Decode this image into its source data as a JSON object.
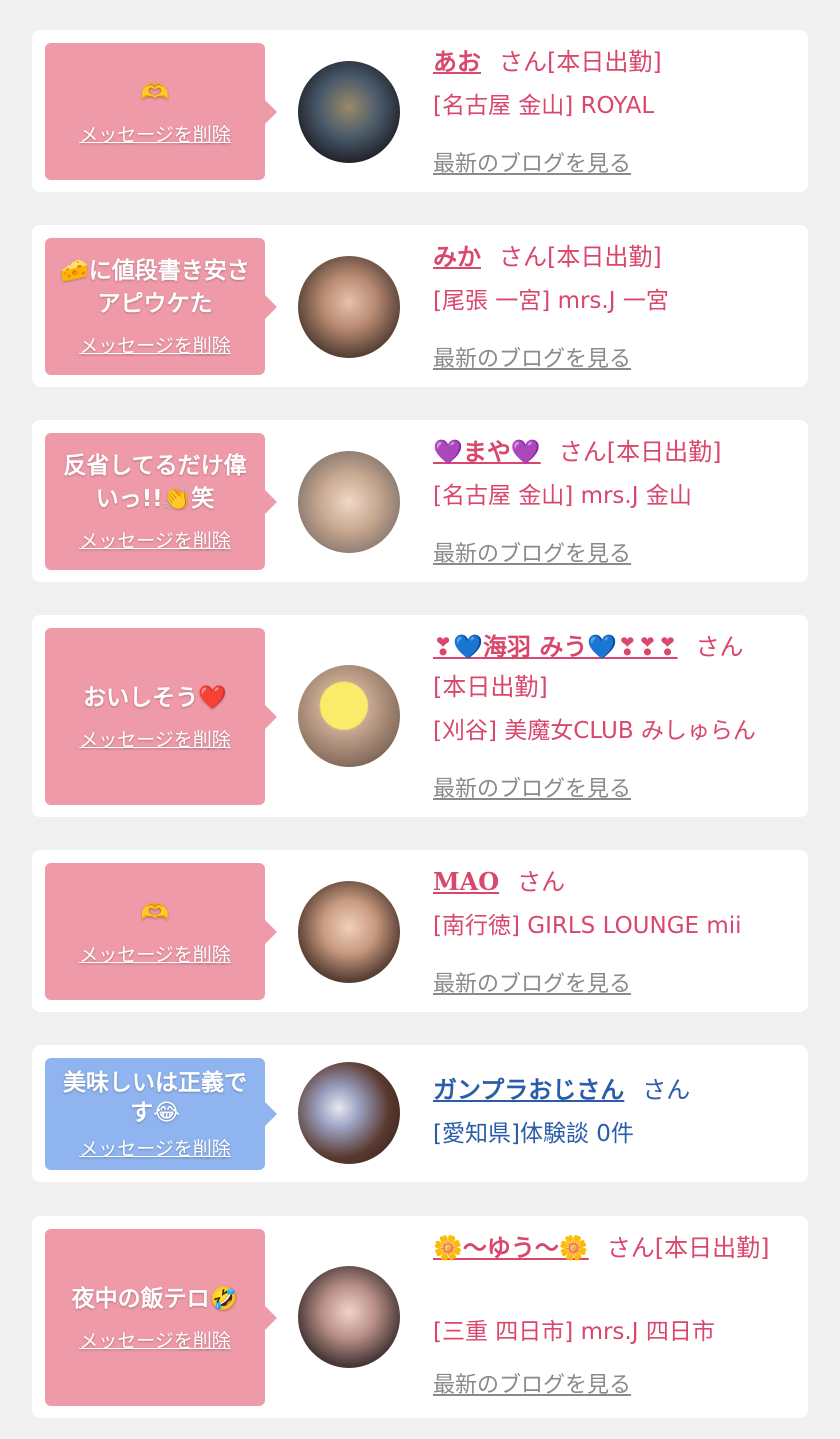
{
  "delete_label": "メッセージを削除",
  "blog_label": "最新のブログを見る",
  "san_label": "さん",
  "cards": [
    {
      "message": "🫶",
      "name": "あお",
      "status": "[本日出勤]",
      "shop": "[名古屋 金山] ROYAL"
    },
    {
      "message": "🧀に値段書き安さアピウケた",
      "name": "みか",
      "status": "[本日出勤]",
      "shop": "[尾張 一宮] mrs.J 一宮"
    },
    {
      "message": "反省してるだけ偉いっ!!👏笑",
      "name": "💜まや💜",
      "status": "[本日出勤]",
      "shop": "[名古屋 金山] mrs.J 金山"
    },
    {
      "message": "おいしそう❤️",
      "name": "❣💙海羽 みう💙❣❣❣",
      "status": "[本日出勤]",
      "shop": "[刈谷] 美魔女CLUB みしゅらん"
    },
    {
      "message": "🫶",
      "name": "MAO",
      "status": "",
      "shop": "[南行徳] GIRLS LOUNGE mii"
    },
    {
      "message": "美味しいは正義です😂",
      "name": "ガンプラおじさん",
      "status": "",
      "shop": "[愛知県]体験談 0件"
    },
    {
      "message": "夜中の飯テロ🤣",
      "name": "🌼〜ゆう〜🌼",
      "status": "[本日出勤]",
      "shop": "[三重 四日市] mrs.J 四日市"
    }
  ],
  "colors": {
    "background": "#f0f0f0",
    "bubble_pink": "#ef9aa8",
    "bubble_blue": "#8fb4ef",
    "name_pink": "#d9476c",
    "name_blue": "#2a5da9",
    "link_gray": "#8a8a8a"
  }
}
